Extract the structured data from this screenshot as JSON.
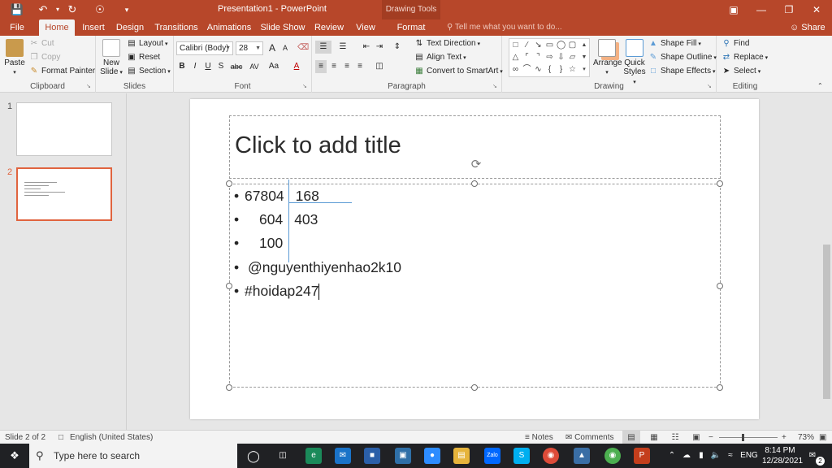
{
  "titlebar": {
    "title": "Presentation1 - PowerPoint",
    "context_label": "Drawing Tools"
  },
  "tabs": [
    "File",
    "Home",
    "Insert",
    "Design",
    "Transitions",
    "Animations",
    "Slide Show",
    "Review",
    "View",
    "Format"
  ],
  "active_tab": "Home",
  "tell_me": "Tell me what you want to do...",
  "share": "Share",
  "ribbon": {
    "clipboard": {
      "label": "Clipboard",
      "paste": "Paste",
      "cut": "Cut",
      "copy": "Copy",
      "format_painter": "Format Painter"
    },
    "slides": {
      "label": "Slides",
      "new_slide_1": "New",
      "new_slide_2": "Slide",
      "layout": "Layout",
      "reset": "Reset",
      "section": "Section"
    },
    "font": {
      "label": "Font",
      "font_name": "Calibri (Body)",
      "font_size": "28",
      "bold": "B",
      "italic": "I",
      "underline": "U",
      "shadow": "S",
      "strike": "abc",
      "spacing": "AV",
      "case": "Aa",
      "color": "A",
      "grow": "A",
      "shrink": "A"
    },
    "paragraph": {
      "label": "Paragraph",
      "text_direction": "Text Direction",
      "align_text": "Align Text",
      "smartart": "Convert to SmartArt"
    },
    "drawing": {
      "label": "Drawing",
      "arrange": "Arrange",
      "quick_styles_1": "Quick",
      "quick_styles_2": "Styles",
      "shape_fill": "Shape Fill",
      "shape_outline": "Shape Outline",
      "shape_effects": "Shape Effects"
    },
    "editing": {
      "label": "Editing",
      "find": "Find",
      "replace": "Replace",
      "select": "Select"
    }
  },
  "thumbnails": [
    {
      "number": "1"
    },
    {
      "number": "2"
    }
  ],
  "slide": {
    "title_placeholder": "Click to add title",
    "lines": [
      {
        "a": "67804",
        "b": "168"
      },
      {
        "a": "604",
        "b": "403"
      },
      {
        "a": "100",
        "b": ""
      },
      {
        "a": "@nguyenthiyenhao2k10",
        "b": ""
      },
      {
        "a": "#hoidap247",
        "b": ""
      }
    ]
  },
  "status": {
    "slide_info": "Slide 2 of 2",
    "language": "English (United States)",
    "notes": "Notes",
    "comments": "Comments",
    "zoom": "73%"
  },
  "taskbar": {
    "search_placeholder": "Type here to search",
    "lang": "ENG",
    "time": "8:14 PM",
    "date": "12/28/2021",
    "notif_count": "2"
  },
  "colors": {
    "accent": "#b7472a",
    "selection": "#e0643f",
    "guide": "#5b9bd5"
  }
}
